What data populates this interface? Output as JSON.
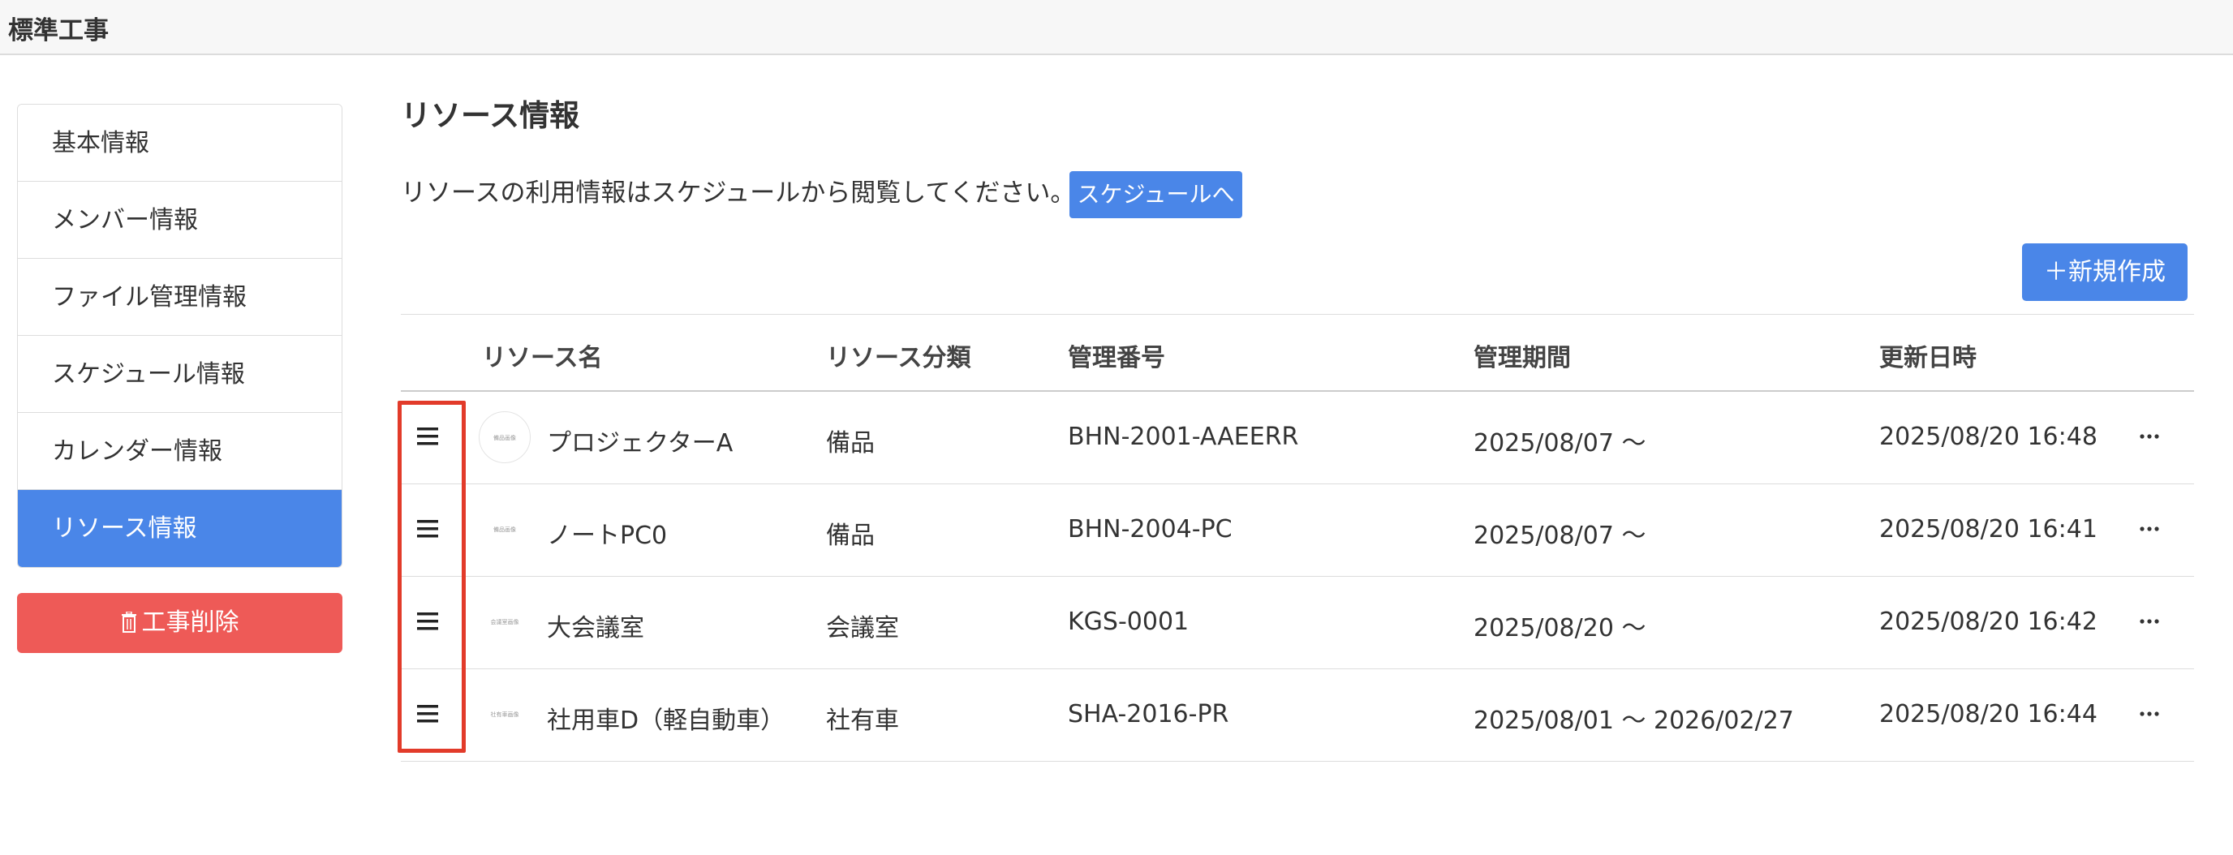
{
  "app": {
    "title": "標準工事"
  },
  "sidebar": {
    "items": [
      {
        "label": "基本情報",
        "active": false
      },
      {
        "label": "メンバー情報",
        "active": false
      },
      {
        "label": "ファイル管理情報",
        "active": false
      },
      {
        "label": "スケジュール情報",
        "active": false
      },
      {
        "label": "カレンダー情報",
        "active": false
      },
      {
        "label": "リソース情報",
        "active": true
      }
    ],
    "delete_button": "工事削除",
    "delete_icon": "trash-icon"
  },
  "main": {
    "title": "リソース情報",
    "info_text": "リソースの利用情報はスケジュールから閲覧してください。",
    "schedule_button": "スケジュールへ",
    "new_button": "＋新規作成"
  },
  "table": {
    "headers": [
      "リソース名",
      "リソース分類",
      "管理番号",
      "管理期間",
      "更新日時"
    ],
    "rows": [
      {
        "thumb": "備品画像",
        "name": "プロジェクターA",
        "category": "備品",
        "code": "BHN-2001-AAEERR",
        "period": "2025/08/07 〜",
        "updated": "2025/08/20 16:48"
      },
      {
        "thumb": "備品画像",
        "name": "ノートPC0",
        "category": "備品",
        "code": "BHN-2004-PC",
        "period": "2025/08/07 〜",
        "updated": "2025/08/20 16:41"
      },
      {
        "thumb": "会議室画像",
        "name": "大会議室",
        "category": "会議室",
        "code": "KGS-0001",
        "period": "2025/08/20 〜",
        "updated": "2025/08/20 16:42"
      },
      {
        "thumb": "社有車画像",
        "name": "社用車D（軽自動車）",
        "category": "社有車",
        "code": "SHA-2016-PR",
        "period": "2025/08/01 〜 2026/02/27",
        "updated": "2025/08/20 16:44"
      }
    ]
  },
  "colors": {
    "accent": "#4a86e8",
    "danger": "#ee5a57",
    "highlight": "#e23b2a"
  }
}
